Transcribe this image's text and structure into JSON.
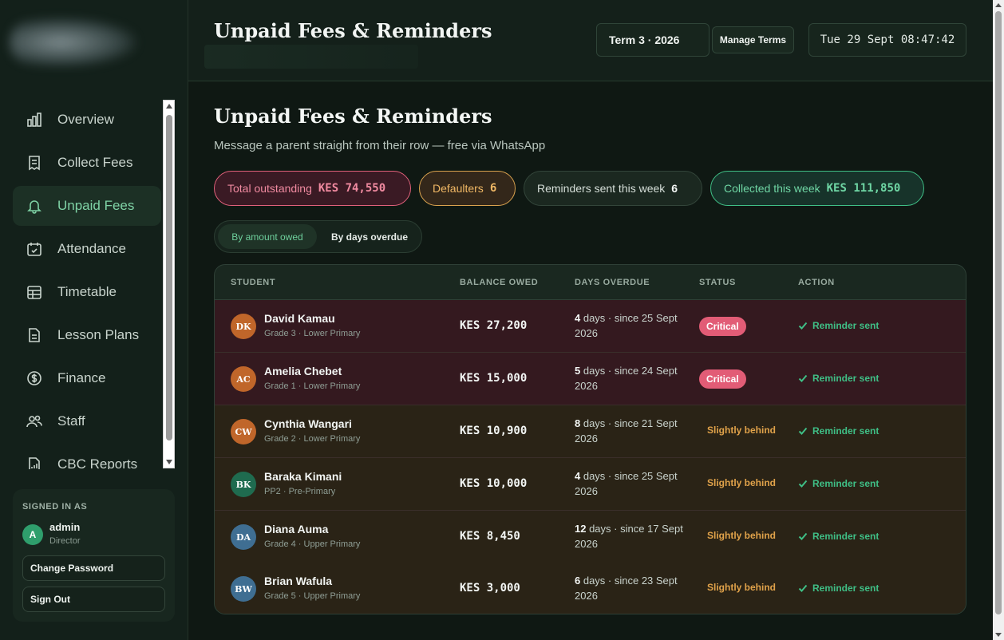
{
  "sidebar": {
    "items": [
      {
        "label": "Overview",
        "icon": "bar-chart-icon"
      },
      {
        "label": "Collect Fees",
        "icon": "receipt-icon"
      },
      {
        "label": "Unpaid Fees",
        "icon": "bell-icon",
        "active": true
      },
      {
        "label": "Attendance",
        "icon": "calendar-check-icon"
      },
      {
        "label": "Timetable",
        "icon": "grid-calendar-icon"
      },
      {
        "label": "Lesson Plans",
        "icon": "document-icon"
      },
      {
        "label": "Finance",
        "icon": "dollar-circle-icon"
      },
      {
        "label": "Staff",
        "icon": "users-icon"
      },
      {
        "label": "CBC Reports",
        "icon": "report-icon"
      }
    ],
    "signed_in": {
      "label": "SIGNED IN AS",
      "avatar": "A",
      "name": "admin",
      "role": "Director",
      "change_password": "Change Password",
      "sign_out": "Sign Out"
    }
  },
  "topbar": {
    "title": "Unpaid Fees & Reminders",
    "term": "Term 3 · 2026",
    "manage_terms": "Manage Terms",
    "clock": "Tue 29 Sept 08:47:42"
  },
  "main": {
    "title": "Unpaid Fees & Reminders",
    "subtitle": "Message a parent straight from their row — free via WhatsApp",
    "stats": {
      "outstanding_label": "Total outstanding",
      "outstanding_value": "KES 74,550",
      "defaulters_label": "Defaulters",
      "defaulters_value": "6",
      "reminders_label": "Reminders sent this week",
      "reminders_value": "6",
      "collected_label": "Collected this week",
      "collected_value": "KES 111,850"
    },
    "sort": {
      "by_amount": "By amount owed",
      "by_days": "By days overdue"
    }
  },
  "table": {
    "headers": {
      "student": "STUDENT",
      "balance": "BALANCE OWED",
      "days": "DAYS OVERDUE",
      "status": "STATUS",
      "action": "ACTION"
    },
    "rows": [
      {
        "initials": "DK",
        "name": "David Kamau",
        "grade": "Grade 3 · Lower Primary",
        "balance": "KES 27,200",
        "days_num": "4",
        "days_text": " days · since 25 Sept 2026",
        "status": "Critical",
        "action": "Reminder sent",
        "avatar_color": "#c0662a"
      },
      {
        "initials": "AC",
        "name": "Amelia Chebet",
        "grade": "Grade 1 · Lower Primary",
        "balance": "KES 15,000",
        "days_num": "5",
        "days_text": " days · since 24 Sept 2026",
        "status": "Critical",
        "action": "Reminder sent",
        "avatar_color": "#c0662a"
      },
      {
        "initials": "CW",
        "name": "Cynthia Wangari",
        "grade": "Grade 2 · Lower Primary",
        "balance": "KES 10,900",
        "days_num": "8",
        "days_text": " days · since 21 Sept 2026",
        "status": "Slightly behind",
        "action": "Reminder sent",
        "avatar_color": "#c0662a"
      },
      {
        "initials": "BK",
        "name": "Baraka Kimani",
        "grade": "PP2 · Pre-Primary",
        "balance": "KES 10,000",
        "days_num": "4",
        "days_text": " days · since 25 Sept 2026",
        "status": "Slightly behind",
        "action": "Reminder sent",
        "avatar_color": "#1f6b4f"
      },
      {
        "initials": "DA",
        "name": "Diana Auma",
        "grade": "Grade 4 · Upper Primary",
        "balance": "KES 8,450",
        "days_num": "12",
        "days_text": " days · since 17 Sept 2026",
        "status": "Slightly behind",
        "action": "Reminder sent",
        "avatar_color": "#3f6e92"
      },
      {
        "initials": "BW",
        "name": "Brian Wafula",
        "grade": "Grade 5 · Upper Primary",
        "balance": "KES 3,000",
        "days_num": "6",
        "days_text": " days · since 23 Sept 2026",
        "status": "Slightly behind",
        "action": "Reminder sent",
        "avatar_color": "#3f6e92"
      }
    ]
  },
  "colors": {
    "accent": "#3fbf86",
    "critical": "#e25c76",
    "behind": "#e0a24a"
  }
}
